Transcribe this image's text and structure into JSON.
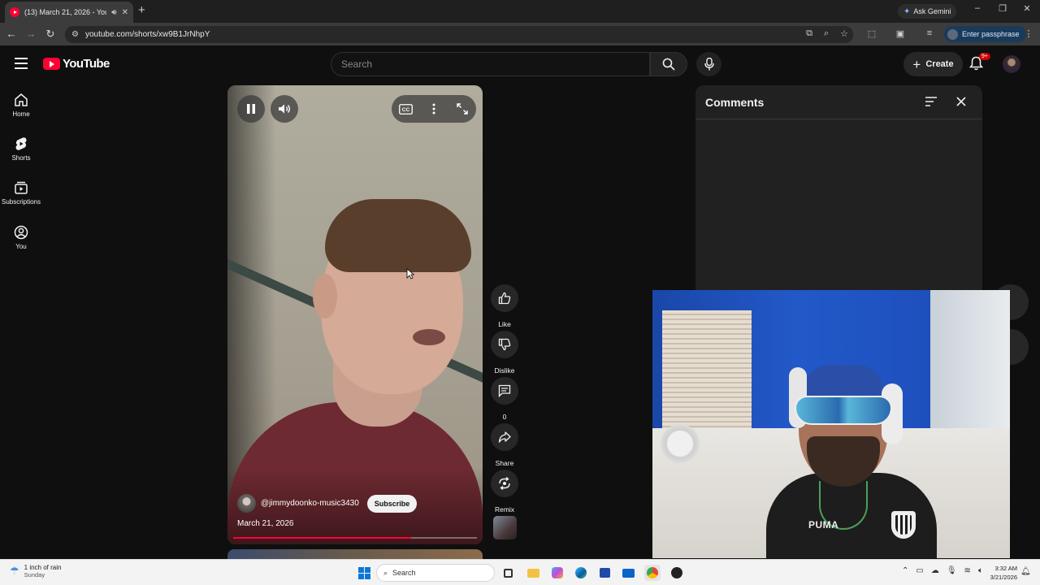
{
  "browser": {
    "tab_title": "(13) March 21, 2026 - YouT",
    "tab_audio_icon": "speaker-icon",
    "new_tab": "+",
    "ask_gemini": "Ask Gemini",
    "url": "youtube.com/shorts/xw9B1JrNhpY",
    "passphrase_label": "Enter passphrase"
  },
  "header": {
    "logo_text": "YouTube",
    "search_placeholder": "Search",
    "create_label": "Create",
    "notif_badge": "9+"
  },
  "sidebar": {
    "items": [
      {
        "label": "Home",
        "icon": "home-icon"
      },
      {
        "label": "Shorts",
        "icon": "shorts-icon"
      },
      {
        "label": "Subscriptions",
        "icon": "subscriptions-icon"
      },
      {
        "label": "You",
        "icon": "you-icon"
      }
    ]
  },
  "short": {
    "channel": "@jimmydoonko-music3430",
    "subscribe_label": "Subscribe",
    "title": "March 21, 2026",
    "progress_fraction": 0.73,
    "cc_label": "CC"
  },
  "actions": {
    "like": "Like",
    "dislike": "Dislike",
    "comments_count": "0",
    "share": "Share",
    "remix": "Remix"
  },
  "comments": {
    "title": "Comments"
  },
  "taskbar": {
    "weather_line1": "1 inch of rain",
    "weather_line2": "Sunday",
    "search_label": "Search",
    "time": "3:32 AM",
    "date": "3/21/2026"
  },
  "colors": {
    "accent": "#ff0033",
    "background": "#0f0f0f",
    "panel": "#212121"
  }
}
